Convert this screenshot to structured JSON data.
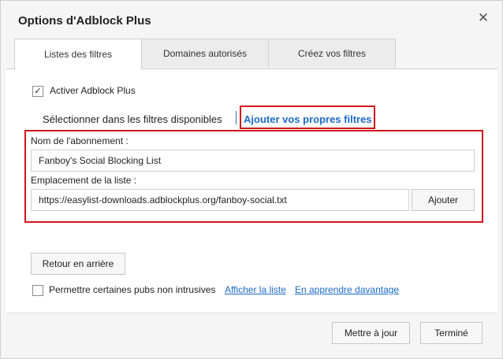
{
  "window": {
    "title": "Options d'Adblock Plus",
    "close_icon": "close-icon"
  },
  "tabs": [
    {
      "label": "Listes des filtres",
      "active": true
    },
    {
      "label": "Domaines autorisés",
      "active": false
    },
    {
      "label": "Créez vos filtres",
      "active": false
    }
  ],
  "enable": {
    "label": "Activer Adblock Plus",
    "checked": true
  },
  "subtabs": {
    "select_label": "Sélectionner dans les filtres disponibles",
    "own_label": "Ajouter vos propres filtres"
  },
  "form": {
    "name_label": "Nom de l'abonnement :",
    "name_value": "Fanboy's Social Blocking List",
    "location_label": "Emplacement de la liste :",
    "location_value": "https://easylist-downloads.adblockplus.org/fanboy-social.txt",
    "add_button": "Ajouter"
  },
  "back_button": "Retour en arrière",
  "acceptable_ads": {
    "label": "Permettre certaines pubs non intrusives",
    "checked": false,
    "show_list_link": "Afficher la liste",
    "learn_more_link": "En apprendre davantage"
  },
  "footer": {
    "update_button": "Mettre à jour",
    "done_button": "Terminé"
  },
  "colors": {
    "accent": "#1b6ac9",
    "highlight": "#d0141b"
  }
}
